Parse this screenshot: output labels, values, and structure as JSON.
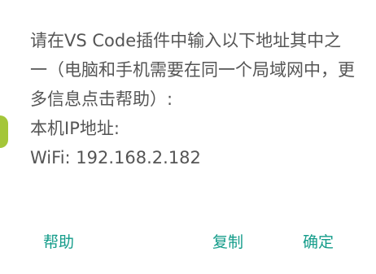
{
  "dialog": {
    "message_lines": [
      "请在VS Code插件中输入以下地址其中之一（电脑和手机需要在同一个局域网中，更多信息点击帮助）:",
      "本机IP地址:",
      "WiFi: 192.168.2.182"
    ],
    "buttons": {
      "help": "帮助",
      "copy": "复制",
      "ok": "确定"
    }
  },
  "colors": {
    "accent": "#149c8a",
    "text": "#555555",
    "background": "#ffffff",
    "bg_peek": "#a4c639"
  }
}
